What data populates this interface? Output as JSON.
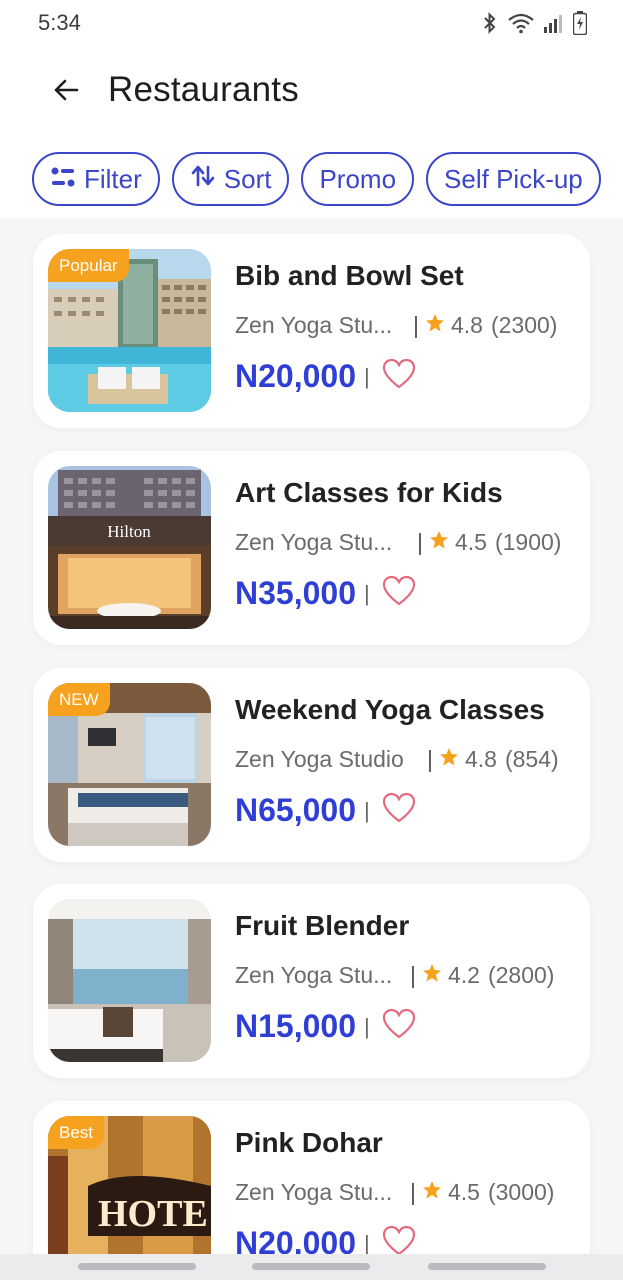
{
  "status_bar": {
    "time": "5:34",
    "icons": [
      "bluetooth-icon",
      "wifi-icon",
      "signal-icon",
      "battery-charging-icon"
    ]
  },
  "header": {
    "title": "Restaurants",
    "back_icon": "arrow-left-icon"
  },
  "chips": [
    {
      "label": "Filter",
      "icon": "filter-icon"
    },
    {
      "label": "Sort",
      "icon": "sort-icon"
    },
    {
      "label": "Promo"
    },
    {
      "label": "Self Pick-up"
    }
  ],
  "colors": {
    "accent": "#3b46c9",
    "price": "#2f3fd6",
    "badge": "#f6a21e",
    "star": "#f6a21e",
    "heart": "#e46a7e"
  },
  "items": [
    {
      "title": "Bib and Bowl Set",
      "vendor": "Zen Yoga Stu...",
      "separator": "|",
      "rating": "4.8",
      "count": "(2300)",
      "price": "N20,000",
      "price_sep": "|",
      "badge": "Popular",
      "image": "resort-pool-image"
    },
    {
      "title": "Art Classes for Kids",
      "vendor": "Zen Yoga Stu...",
      "separator": "|",
      "rating": "4.5",
      "count": "(1900)",
      "price": "N35,000",
      "price_sep": "|",
      "badge": "",
      "image": "hilton-hotel-image",
      "image_sign": "Hilton"
    },
    {
      "title": "Weekend Yoga Classes",
      "vendor": "Zen Yoga Studio",
      "separator": "|",
      "rating": "4.8",
      "count": "(854)",
      "price": "N65,000",
      "price_sep": "|",
      "badge": "NEW",
      "image": "hotel-room-image"
    },
    {
      "title": "Fruit Blender",
      "vendor": "Zen Yoga Stu...",
      "separator": "|",
      "rating": "4.2",
      "count": "(2800)",
      "price": "N15,000",
      "price_sep": "|",
      "badge": "",
      "image": "seaview-bedroom-image"
    },
    {
      "title": "Pink Dohar",
      "vendor": "Zen Yoga Stu...",
      "separator": "|",
      "rating": "4.5",
      "count": "(3000)",
      "price": "N20,000",
      "price_sep": "|",
      "badge": "Best",
      "image": "hotel-sign-image",
      "image_sign": "HOTE"
    }
  ]
}
